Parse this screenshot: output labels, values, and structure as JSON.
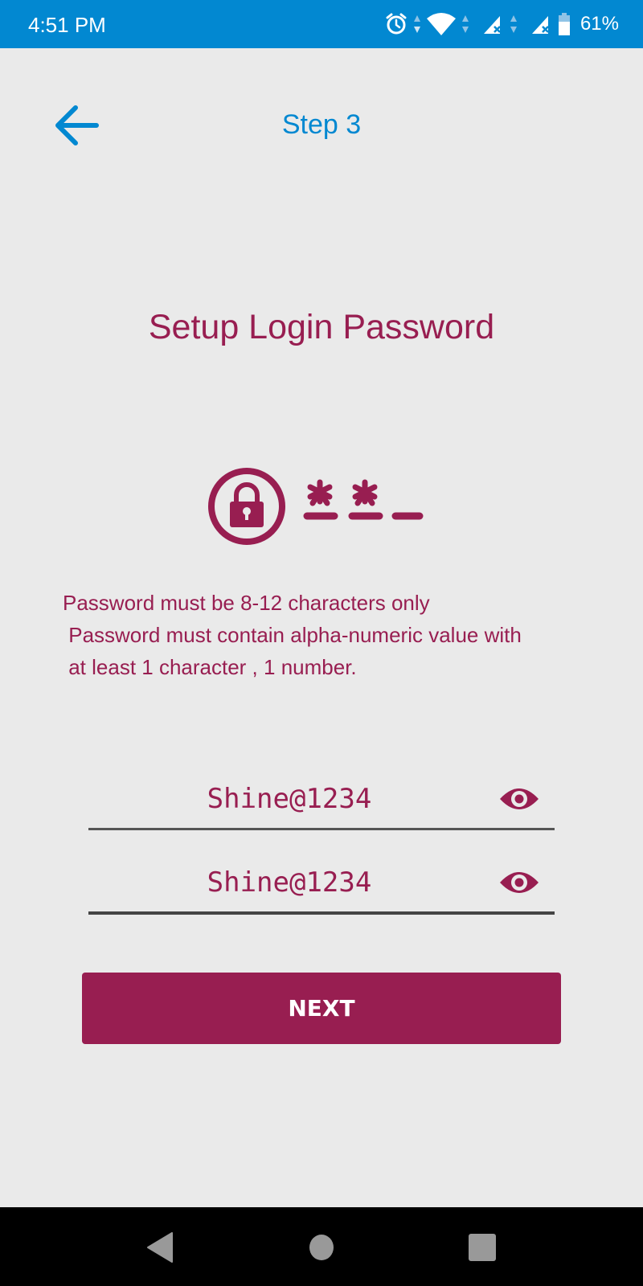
{
  "status_bar": {
    "time": "4:51 PM",
    "battery_percent": "61%",
    "icons": [
      "alarm-icon",
      "wifi-icon",
      "signal-icon",
      "signal-icon",
      "battery-icon"
    ]
  },
  "header": {
    "back_icon": "arrow-left-icon",
    "step_label": "Step 3"
  },
  "main": {
    "title": "Setup Login Password",
    "illustration_icon": "lock-password-icon",
    "rules": [
      "Password must be 8-12 characters only",
      " Password must contain alpha-numeric value with",
      " at least 1 character , 1 number."
    ],
    "fields": [
      {
        "name": "password",
        "value": "Shine@1234",
        "toggle_icon": "eye-icon"
      },
      {
        "name": "confirm-password",
        "value": "Shine@1234",
        "toggle_icon": "eye-icon"
      }
    ],
    "next_label": "NEXT"
  },
  "nav_bar": {
    "buttons": [
      "back-triangle-icon",
      "home-circle-icon",
      "recents-square-icon"
    ]
  },
  "colors": {
    "accent_blue": "#0288d1",
    "brand_maroon": "#981e51",
    "background": "#eaeaea"
  }
}
